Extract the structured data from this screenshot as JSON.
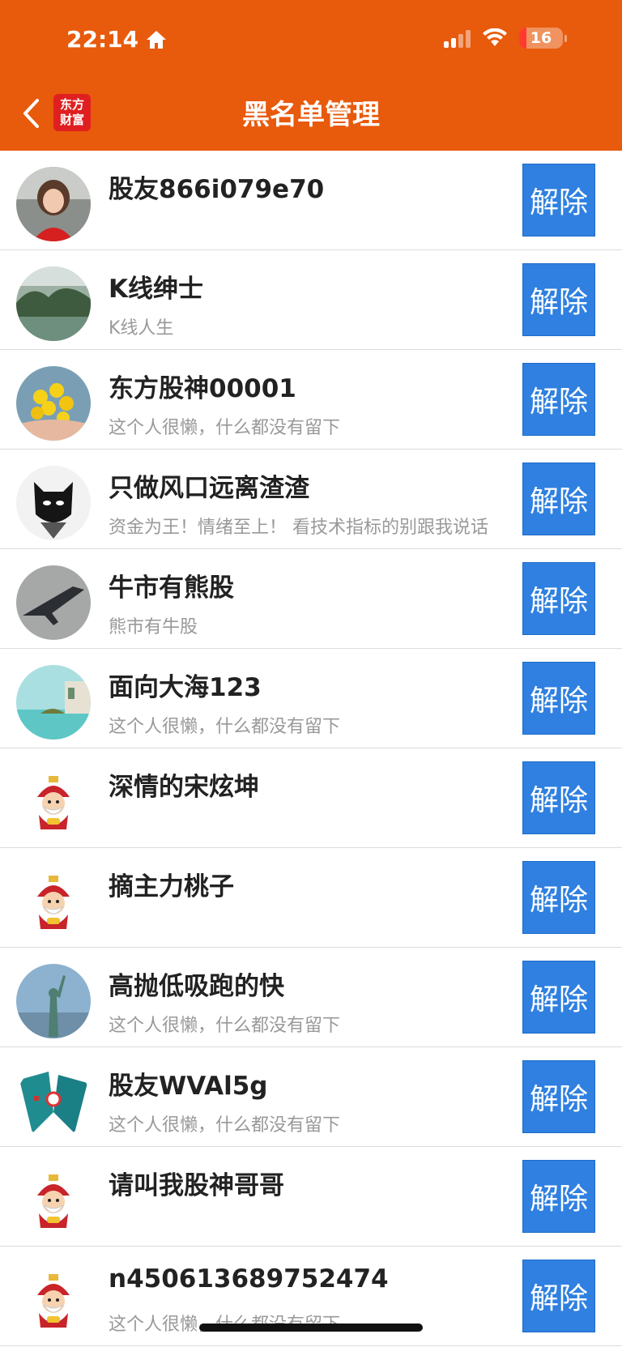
{
  "status_bar": {
    "time": "22:14",
    "battery_level": "16",
    "battery_fraction": 0.16,
    "icons": [
      "home-icon",
      "signal-icon",
      "wifi-icon",
      "battery-icon"
    ]
  },
  "nav": {
    "back_icon": "chevron-left-icon",
    "logo_text": "东方财富",
    "title": "黑名单管理"
  },
  "colors": {
    "header_bg": "#e85a0c",
    "button_bg": "#2f80e0",
    "name_text": "#222222",
    "signature_text": "#999999"
  },
  "blocklist": [
    {
      "name": "股友866i079e70",
      "signature": "",
      "button": "解除",
      "avatar": "portrait-photo"
    },
    {
      "name": "K线绅士",
      "signature": "K线人生",
      "button": "解除",
      "avatar": "landscape-photo"
    },
    {
      "name": "东方股神00001",
      "signature": "这个人很懒，什么都没有留下",
      "button": "解除",
      "avatar": "flowers-photo"
    },
    {
      "name": "只做风口远离渣渣",
      "signature": "资金为王！情绪至上！ 看技术指标的别跟我说话",
      "button": "解除",
      "avatar": "batman-mask"
    },
    {
      "name": "牛市有熊股",
      "signature": "熊市有牛股",
      "button": "解除",
      "avatar": "jet-photo"
    },
    {
      "name": "面向大海123",
      "signature": "这个人很懒，什么都没有留下",
      "button": "解除",
      "avatar": "sea-photo"
    },
    {
      "name": "深情的宋炫坤",
      "signature": "",
      "button": "解除",
      "avatar": "fortune-god-cartoon"
    },
    {
      "name": "摘主力桃子",
      "signature": "",
      "button": "解除",
      "avatar": "fortune-god-cartoon"
    },
    {
      "name": "高抛低吸跑的快",
      "signature": "这个人很懒，什么都没有留下",
      "button": "解除",
      "avatar": "statue-photo"
    },
    {
      "name": "股友WVAl5g",
      "signature": "这个人很懒，什么都没有留下",
      "button": "解除",
      "avatar": "teal-pattern"
    },
    {
      "name": "请叫我股神哥哥",
      "signature": "",
      "button": "解除",
      "avatar": "fortune-god-cartoon"
    },
    {
      "name": "n450613689752474",
      "signature": "这个人很懒，什么都没有留下",
      "button": "解除",
      "avatar": "fortune-god-cartoon"
    }
  ]
}
